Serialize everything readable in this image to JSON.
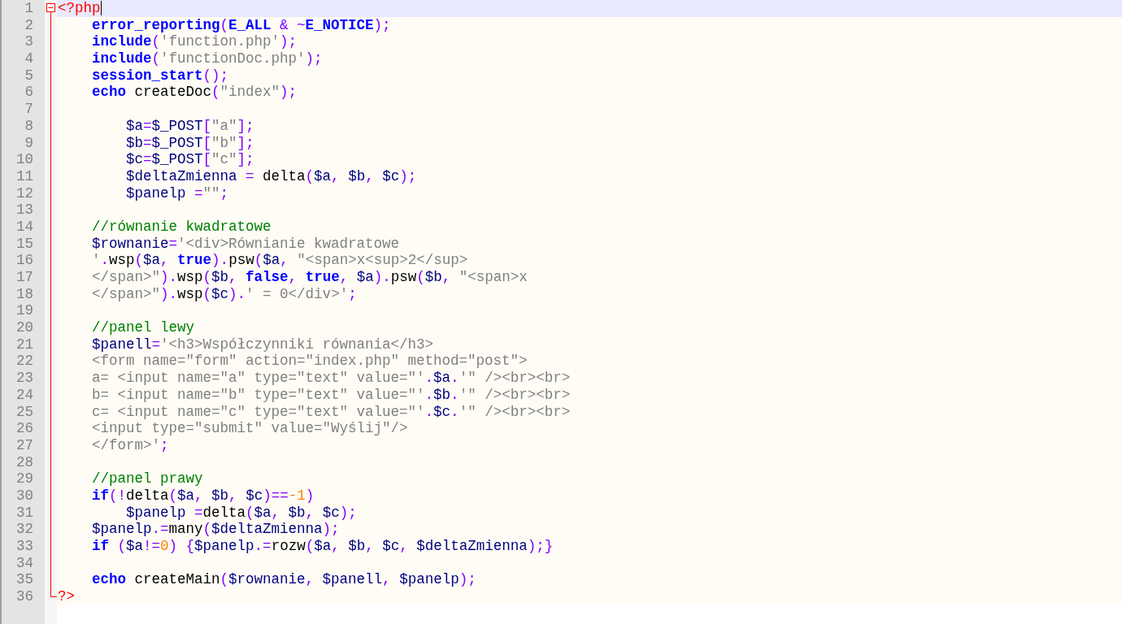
{
  "editor": {
    "fold_expanded": true,
    "lines": [
      {
        "number": "1",
        "current": true,
        "tokens": [
          {
            "kind": "tag",
            "text": "<?php"
          }
        ]
      },
      {
        "number": "2",
        "current": false,
        "tokens": [
          {
            "kind": "kw",
            "text": "    error_reporting"
          },
          {
            "kind": "op",
            "text": "("
          },
          {
            "kind": "kw",
            "text": "E_ALL"
          },
          {
            "kind": "op",
            "text": " & ~"
          },
          {
            "kind": "kw",
            "text": "E_NOTICE"
          },
          {
            "kind": "op",
            "text": ");"
          }
        ]
      },
      {
        "number": "3",
        "current": false,
        "tokens": [
          {
            "kind": "kw",
            "text": "    include"
          },
          {
            "kind": "op",
            "text": "("
          },
          {
            "kind": "str",
            "text": "'function.php'"
          },
          {
            "kind": "op",
            "text": ");"
          }
        ]
      },
      {
        "number": "4",
        "current": false,
        "tokens": [
          {
            "kind": "kw",
            "text": "    include"
          },
          {
            "kind": "op",
            "text": "("
          },
          {
            "kind": "str",
            "text": "'functionDoc.php'"
          },
          {
            "kind": "op",
            "text": ");"
          }
        ]
      },
      {
        "number": "5",
        "current": false,
        "tokens": [
          {
            "kind": "kw",
            "text": "    session_start"
          },
          {
            "kind": "op",
            "text": "();"
          }
        ]
      },
      {
        "number": "6",
        "current": false,
        "tokens": [
          {
            "kind": "kw",
            "text": "    echo"
          },
          {
            "kind": "fn",
            "text": " createDoc"
          },
          {
            "kind": "op",
            "text": "("
          },
          {
            "kind": "str",
            "text": "\"index\""
          },
          {
            "kind": "op",
            "text": ");"
          }
        ]
      },
      {
        "number": "7",
        "current": false
      },
      {
        "number": "8",
        "current": false,
        "tokens": [
          {
            "kind": "var",
            "text": "        $a"
          },
          {
            "kind": "op",
            "text": "="
          },
          {
            "kind": "var",
            "text": "$_POST"
          },
          {
            "kind": "op",
            "text": "["
          },
          {
            "kind": "str",
            "text": "\"a\""
          },
          {
            "kind": "op",
            "text": "];"
          }
        ]
      },
      {
        "number": "9",
        "current": false,
        "tokens": [
          {
            "kind": "var",
            "text": "        $b"
          },
          {
            "kind": "op",
            "text": "="
          },
          {
            "kind": "var",
            "text": "$_POST"
          },
          {
            "kind": "op",
            "text": "["
          },
          {
            "kind": "str",
            "text": "\"b\""
          },
          {
            "kind": "op",
            "text": "];"
          }
        ]
      },
      {
        "number": "10",
        "current": false,
        "tokens": [
          {
            "kind": "var",
            "text": "        $c"
          },
          {
            "kind": "op",
            "text": "="
          },
          {
            "kind": "var",
            "text": "$_POST"
          },
          {
            "kind": "op",
            "text": "["
          },
          {
            "kind": "str",
            "text": "\"c\""
          },
          {
            "kind": "op",
            "text": "];"
          }
        ]
      },
      {
        "number": "11",
        "current": false,
        "tokens": [
          {
            "kind": "var",
            "text": "        $deltaZmienna"
          },
          {
            "kind": "op",
            "text": " = "
          },
          {
            "kind": "fn",
            "text": "delta"
          },
          {
            "kind": "op",
            "text": "("
          },
          {
            "kind": "var",
            "text": "$a"
          },
          {
            "kind": "op",
            "text": ", "
          },
          {
            "kind": "var",
            "text": "$b"
          },
          {
            "kind": "op",
            "text": ", "
          },
          {
            "kind": "var",
            "text": "$c"
          },
          {
            "kind": "op",
            "text": ");"
          }
        ]
      },
      {
        "number": "12",
        "current": false,
        "tokens": [
          {
            "kind": "var",
            "text": "        $panelp"
          },
          {
            "kind": "op",
            "text": " ="
          },
          {
            "kind": "str",
            "text": "\"\""
          },
          {
            "kind": "op",
            "text": ";"
          }
        ]
      },
      {
        "number": "13",
        "current": false
      },
      {
        "number": "14",
        "current": false,
        "tokens": [
          {
            "kind": "cmt",
            "text": "    //równanie kwadratowe"
          }
        ]
      },
      {
        "number": "15",
        "current": false,
        "tokens": [
          {
            "kind": "var",
            "text": "    $rownanie"
          },
          {
            "kind": "op",
            "text": "="
          },
          {
            "kind": "str",
            "text": "'<div>Równianie kwadratowe "
          }
        ]
      },
      {
        "number": "16",
        "current": false,
        "tokens": [
          {
            "kind": "str",
            "text": "    '"
          },
          {
            "kind": "op",
            "text": "."
          },
          {
            "kind": "fn",
            "text": "wsp"
          },
          {
            "kind": "op",
            "text": "("
          },
          {
            "kind": "var",
            "text": "$a"
          },
          {
            "kind": "op",
            "text": ", "
          },
          {
            "kind": "kw",
            "text": "true"
          },
          {
            "kind": "op",
            "text": ")."
          },
          {
            "kind": "fn",
            "text": "psw"
          },
          {
            "kind": "op",
            "text": "("
          },
          {
            "kind": "var",
            "text": "$a"
          },
          {
            "kind": "op",
            "text": ", "
          },
          {
            "kind": "str",
            "text": "\"<span>x<sup>2</sup> "
          }
        ]
      },
      {
        "number": "17",
        "current": false,
        "tokens": [
          {
            "kind": "str",
            "text": "    </span>\""
          },
          {
            "kind": "op",
            "text": ")."
          },
          {
            "kind": "fn",
            "text": "wsp"
          },
          {
            "kind": "op",
            "text": "("
          },
          {
            "kind": "var",
            "text": "$b"
          },
          {
            "kind": "op",
            "text": ", "
          },
          {
            "kind": "kw",
            "text": "false"
          },
          {
            "kind": "op",
            "text": ", "
          },
          {
            "kind": "kw",
            "text": "true"
          },
          {
            "kind": "op",
            "text": ", "
          },
          {
            "kind": "var",
            "text": "$a"
          },
          {
            "kind": "op",
            "text": ")."
          },
          {
            "kind": "fn",
            "text": "psw"
          },
          {
            "kind": "op",
            "text": "("
          },
          {
            "kind": "var",
            "text": "$b"
          },
          {
            "kind": "op",
            "text": ", "
          },
          {
            "kind": "str",
            "text": "\"<span>x "
          }
        ]
      },
      {
        "number": "18",
        "current": false,
        "tokens": [
          {
            "kind": "str",
            "text": "    </span>\""
          },
          {
            "kind": "op",
            "text": ")."
          },
          {
            "kind": "fn",
            "text": "wsp"
          },
          {
            "kind": "op",
            "text": "("
          },
          {
            "kind": "var",
            "text": "$c"
          },
          {
            "kind": "op",
            "text": ")."
          },
          {
            "kind": "str",
            "text": "' = 0</div>'"
          },
          {
            "kind": "op",
            "text": ";"
          }
        ]
      },
      {
        "number": "19",
        "current": false
      },
      {
        "number": "20",
        "current": false,
        "tokens": [
          {
            "kind": "cmt",
            "text": "    //panel lewy"
          }
        ]
      },
      {
        "number": "21",
        "current": false,
        "tokens": [
          {
            "kind": "var",
            "text": "    $panell"
          },
          {
            "kind": "op",
            "text": "="
          },
          {
            "kind": "str",
            "text": "'<h3>Współczynniki równania</h3> "
          }
        ]
      },
      {
        "number": "22",
        "current": false,
        "tokens": [
          {
            "kind": "str",
            "text": "    <form name=\"form\" action=\"index.php\" method=\"post\"> "
          }
        ]
      },
      {
        "number": "23",
        "current": false,
        "tokens": [
          {
            "kind": "str",
            "text": "    a= <input name=\"a\" type=\"text\" value=\"'"
          },
          {
            "kind": "op",
            "text": "."
          },
          {
            "kind": "var",
            "text": "$a"
          },
          {
            "kind": "op",
            "text": "."
          },
          {
            "kind": "str",
            "text": "'\" /><br><br> "
          }
        ]
      },
      {
        "number": "24",
        "current": false,
        "tokens": [
          {
            "kind": "str",
            "text": "    b= <input name=\"b\" type=\"text\" value=\"'"
          },
          {
            "kind": "op",
            "text": "."
          },
          {
            "kind": "var",
            "text": "$b"
          },
          {
            "kind": "op",
            "text": "."
          },
          {
            "kind": "str",
            "text": "'\" /><br><br> "
          }
        ]
      },
      {
        "number": "25",
        "current": false,
        "tokens": [
          {
            "kind": "str",
            "text": "    c= <input name=\"c\" type=\"text\" value=\"'"
          },
          {
            "kind": "op",
            "text": "."
          },
          {
            "kind": "var",
            "text": "$c"
          },
          {
            "kind": "op",
            "text": "."
          },
          {
            "kind": "str",
            "text": "'\" /><br><br> "
          }
        ]
      },
      {
        "number": "26",
        "current": false,
        "tokens": [
          {
            "kind": "str",
            "text": "    <input type=\"submit\" value=\"Wyślij\"/> "
          }
        ]
      },
      {
        "number": "27",
        "current": false,
        "tokens": [
          {
            "kind": "str",
            "text": "    </form>'"
          },
          {
            "kind": "op",
            "text": ";"
          }
        ]
      },
      {
        "number": "28",
        "current": false
      },
      {
        "number": "29",
        "current": false,
        "tokens": [
          {
            "kind": "cmt",
            "text": "    //panel prawy"
          }
        ]
      },
      {
        "number": "30",
        "current": false,
        "tokens": [
          {
            "kind": "kw",
            "text": "    if"
          },
          {
            "kind": "op",
            "text": "(!"
          },
          {
            "kind": "fn",
            "text": "delta"
          },
          {
            "kind": "op",
            "text": "("
          },
          {
            "kind": "var",
            "text": "$a"
          },
          {
            "kind": "op",
            "text": ", "
          },
          {
            "kind": "var",
            "text": "$b"
          },
          {
            "kind": "op",
            "text": ", "
          },
          {
            "kind": "var",
            "text": "$c"
          },
          {
            "kind": "op",
            "text": ")=="
          },
          {
            "kind": "num",
            "text": "-1"
          },
          {
            "kind": "op",
            "text": ")"
          }
        ]
      },
      {
        "number": "31",
        "current": false,
        "tokens": [
          {
            "kind": "var",
            "text": "        $panelp"
          },
          {
            "kind": "op",
            "text": " ="
          },
          {
            "kind": "fn",
            "text": "delta"
          },
          {
            "kind": "op",
            "text": "("
          },
          {
            "kind": "var",
            "text": "$a"
          },
          {
            "kind": "op",
            "text": ", "
          },
          {
            "kind": "var",
            "text": "$b"
          },
          {
            "kind": "op",
            "text": ", "
          },
          {
            "kind": "var",
            "text": "$c"
          },
          {
            "kind": "op",
            "text": ");"
          }
        ]
      },
      {
        "number": "32",
        "current": false,
        "tokens": [
          {
            "kind": "var",
            "text": "    $panelp"
          },
          {
            "kind": "op",
            "text": ".="
          },
          {
            "kind": "fn",
            "text": "many"
          },
          {
            "kind": "op",
            "text": "("
          },
          {
            "kind": "var",
            "text": "$deltaZmienna"
          },
          {
            "kind": "op",
            "text": ");"
          }
        ]
      },
      {
        "number": "33",
        "current": false,
        "tokens": [
          {
            "kind": "kw",
            "text": "    if"
          },
          {
            "kind": "op",
            "text": " ("
          },
          {
            "kind": "var",
            "text": "$a"
          },
          {
            "kind": "op",
            "text": "!="
          },
          {
            "kind": "num",
            "text": "0"
          },
          {
            "kind": "op",
            "text": ") {"
          },
          {
            "kind": "var",
            "text": "$panelp"
          },
          {
            "kind": "op",
            "text": ".="
          },
          {
            "kind": "fn",
            "text": "rozw"
          },
          {
            "kind": "op",
            "text": "("
          },
          {
            "kind": "var",
            "text": "$a"
          },
          {
            "kind": "op",
            "text": ", "
          },
          {
            "kind": "var",
            "text": "$b"
          },
          {
            "kind": "op",
            "text": ", "
          },
          {
            "kind": "var",
            "text": "$c"
          },
          {
            "kind": "op",
            "text": ", "
          },
          {
            "kind": "var",
            "text": "$deltaZmienna"
          },
          {
            "kind": "op",
            "text": ");}"
          }
        ]
      },
      {
        "number": "34",
        "current": false
      },
      {
        "number": "35",
        "current": false,
        "tokens": [
          {
            "kind": "kw",
            "text": "    echo"
          },
          {
            "kind": "fn",
            "text": " createMain"
          },
          {
            "kind": "op",
            "text": "("
          },
          {
            "kind": "var",
            "text": "$rownanie"
          },
          {
            "kind": "op",
            "text": ", "
          },
          {
            "kind": "var",
            "text": "$panell"
          },
          {
            "kind": "op",
            "text": ", "
          },
          {
            "kind": "var",
            "text": "$panelp"
          },
          {
            "kind": "op",
            "text": ");"
          }
        ]
      },
      {
        "number": "36",
        "current": false,
        "tokens": [
          {
            "kind": "tag",
            "text": "?>"
          }
        ]
      }
    ]
  }
}
